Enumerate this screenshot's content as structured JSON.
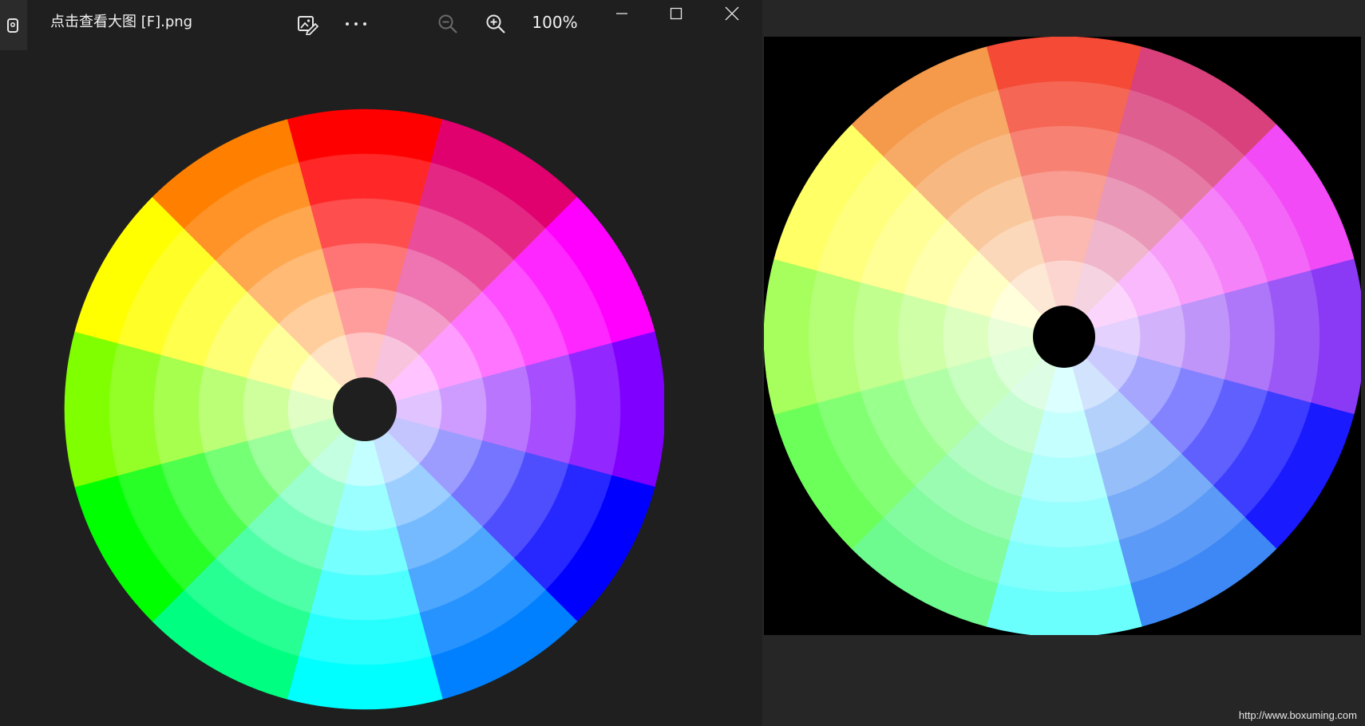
{
  "window": {
    "title": "点击查看大图 [F].png",
    "zoom_level": "100%"
  },
  "toolbar": {
    "icons": [
      "edit-image-icon",
      "more-options-icon",
      "zoom-out-icon",
      "zoom-in-icon"
    ]
  },
  "window_controls": {
    "icons": [
      "minimize-icon",
      "maximize-icon",
      "close-icon"
    ]
  },
  "colors": {
    "background": "#1f1f1f",
    "right_panel": "#262626",
    "titlebar_text": "#f2f2f2"
  },
  "color_wheel": {
    "segments": 12,
    "rings": 6,
    "left_hues": [
      "#ff0000",
      "#e0006e",
      "#ff00ff",
      "#8000ff",
      "#0000ff",
      "#0080ff",
      "#00ffff",
      "#00ff80",
      "#00ff00",
      "#80ff00",
      "#ffff00",
      "#ff8000"
    ],
    "right_hues": [
      "#f44a36",
      "#d9417c",
      "#f24af6",
      "#8a3af5",
      "#1a1aff",
      "#3d88f5",
      "#6afffd",
      "#6dfa8e",
      "#6cff5a",
      "#a6ff5c",
      "#ffff66",
      "#f5994a"
    ]
  },
  "watermark": "http://www.boxuming.com"
}
